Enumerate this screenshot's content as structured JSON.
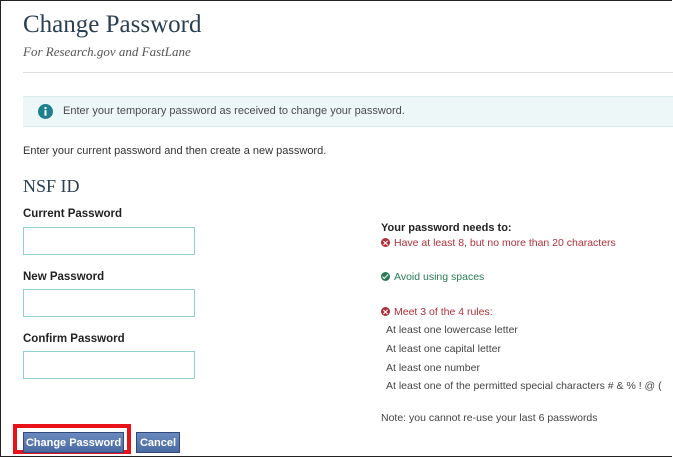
{
  "header": {
    "title": "Change Password",
    "subtitle": "For Research.gov and FastLane"
  },
  "alert": {
    "icon": "info-icon",
    "text": "Enter your temporary password as received to change your password."
  },
  "instruction": "Enter your current password and then create a new password.",
  "form": {
    "section_title": "NSF ID",
    "current_password": {
      "label": "Current Password",
      "value": ""
    },
    "new_password": {
      "label": "New Password",
      "value": ""
    },
    "confirm_password": {
      "label": "Confirm Password",
      "value": ""
    }
  },
  "requirements": {
    "heading": "Your password needs to:",
    "rule_length": {
      "status": "fail",
      "text": "Have at least 8, but no more than 20 characters"
    },
    "rule_spaces": {
      "status": "pass",
      "text": "Avoid using spaces"
    },
    "rule_meet": {
      "status": "fail",
      "text": "Meet 3 of the 4 rules:"
    },
    "sub_rules": [
      "At least one lowercase letter",
      "At least one capital letter",
      "At least one number",
      "At least one of the permitted special characters # & % ! @ ("
    ],
    "note": "Note: you cannot re-use your last 6 passwords"
  },
  "buttons": {
    "change_password": "Change Password",
    "cancel": "Cancel"
  },
  "colors": {
    "error": "#b0303a",
    "success": "#2a7a58",
    "highlight": "#e8121a",
    "button": "#4a6aa3"
  }
}
